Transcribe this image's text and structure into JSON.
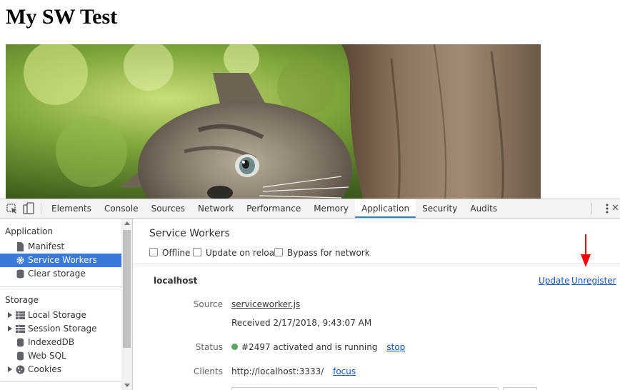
{
  "page": {
    "title": "My SW Test"
  },
  "devtools": {
    "tabs": [
      "Elements",
      "Console",
      "Sources",
      "Network",
      "Performance",
      "Memory",
      "Application",
      "Security",
      "Audits"
    ],
    "active_tab": "Application",
    "sidebar": {
      "application_heading": "Application",
      "application_items": [
        {
          "label": "Manifest",
          "icon": "file-icon"
        },
        {
          "label": "Service Workers",
          "icon": "gear-icon",
          "selected": true
        },
        {
          "label": "Clear storage",
          "icon": "database-icon"
        }
      ],
      "storage_heading": "Storage",
      "storage_items": [
        {
          "label": "Local Storage",
          "icon": "grid-icon",
          "expandable": true
        },
        {
          "label": "Session Storage",
          "icon": "grid-icon",
          "expandable": true
        },
        {
          "label": "IndexedDB",
          "icon": "database-icon",
          "expandable": false
        },
        {
          "label": "Web SQL",
          "icon": "database-icon",
          "expandable": false
        },
        {
          "label": "Cookies",
          "icon": "cookie-icon",
          "expandable": true
        }
      ]
    },
    "service_workers": {
      "title": "Service Workers",
      "options": [
        "Offline",
        "Update on reload",
        "Bypass for network"
      ],
      "origin": "localhost",
      "update_link": "Update",
      "unregister_link": "Unregister",
      "source_label": "Source",
      "source_file": "serviceworker.js",
      "received": "Received 2/17/2018, 9:43:07 AM",
      "status_label": "Status",
      "status_text": "#2497 activated and is running",
      "stop_link": "stop",
      "clients_label": "Clients",
      "clients_url": "http://localhost:3333/",
      "focus_link": "focus"
    }
  },
  "colors": {
    "accent": "#3879d9",
    "link": "#1155cc",
    "status_running": "#5ea35e",
    "annotation_arrow": "#ff0000"
  }
}
